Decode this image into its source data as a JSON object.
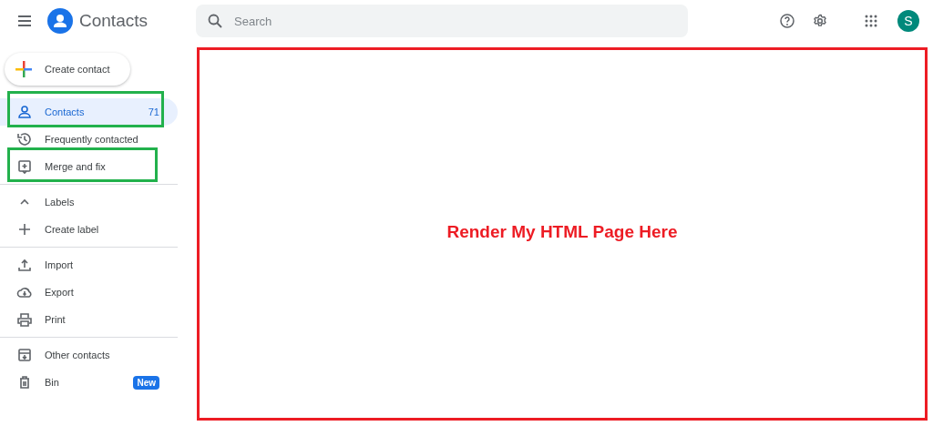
{
  "header": {
    "app_title": "Contacts",
    "search": {
      "placeholder": "Search"
    },
    "avatar": "S"
  },
  "create_button": "Create contact",
  "sidebar": {
    "groups": [
      {
        "items": [
          {
            "label": "Contacts",
            "count": "71",
            "selected": true,
            "highlighted": true
          },
          {
            "label": "Frequently contacted",
            "selected": false,
            "highlighted": false
          },
          {
            "label": "Merge and fix",
            "selected": false,
            "highlighted": true
          }
        ]
      },
      {
        "items": [
          {
            "label": "Labels",
            "selected": false,
            "highlighted": false
          },
          {
            "label": "Create label",
            "selected": false,
            "highlighted": false
          }
        ]
      },
      {
        "items": [
          {
            "label": "Import",
            "selected": false,
            "highlighted": false
          },
          {
            "label": "Export",
            "selected": false,
            "highlighted": false
          },
          {
            "label": "Print",
            "selected": false,
            "highlighted": false
          }
        ]
      },
      {
        "items": [
          {
            "label": "Other contacts",
            "selected": false,
            "highlighted": false
          },
          {
            "label": "Bin",
            "badge": "New",
            "selected": false,
            "highlighted": false
          }
        ]
      }
    ]
  },
  "main": {
    "placeholder_text": "Render My HTML Page Here"
  }
}
